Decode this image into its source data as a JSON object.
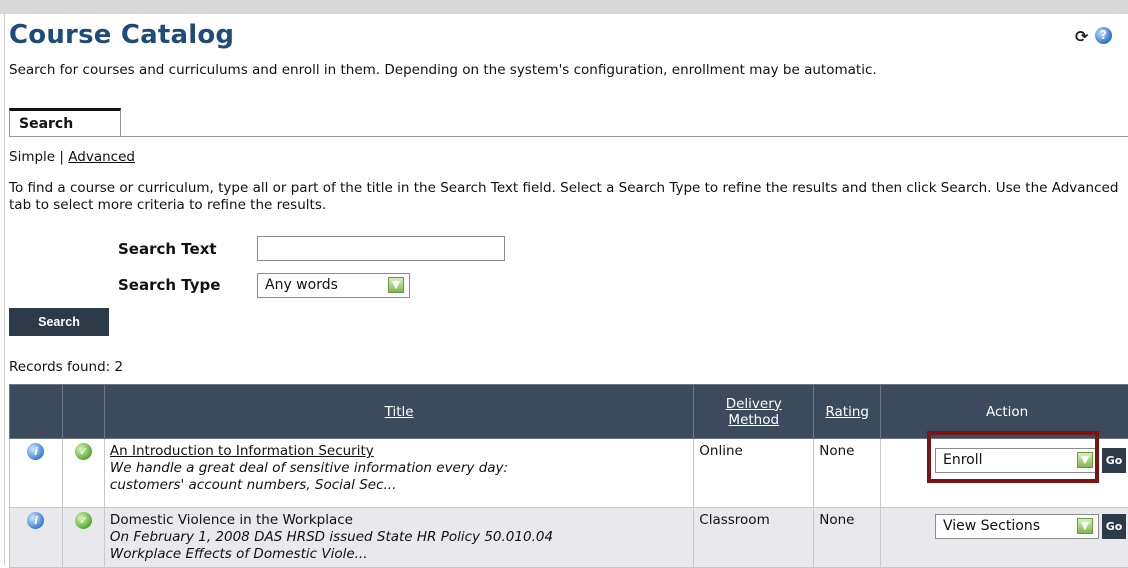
{
  "page": {
    "title": "Course Catalog",
    "description": "Search for courses and curriculums and enroll in them. Depending on the system's configuration, enrollment may be automatic.",
    "refresh_icon": "refresh-icon",
    "help_icon": "help-icon"
  },
  "tabs": [
    {
      "label": "Search",
      "active": true
    }
  ],
  "modes": {
    "simple": "Simple",
    "separator": "|",
    "advanced": "Advanced"
  },
  "instructions": "To find a course or curriculum, type all or part of the title in the Search Text field. Select a Search Type to refine the results and then click Search. Use the Advanced tab to select more criteria to refine the results.",
  "form": {
    "search_text_label": "Search Text",
    "search_text_value": "",
    "search_type_label": "Search Type",
    "search_type_value": "Any words",
    "search_button": "Search"
  },
  "records_found": "Records found: 2",
  "table": {
    "headers": {
      "title": "Title",
      "delivery_line1": "Delivery",
      "delivery_line2": "Method",
      "rating": "Rating",
      "action": "Action"
    },
    "rows": [
      {
        "title": "An Introduction to Information Security",
        "desc_line1": "We handle a great deal of sensitive information every day:",
        "desc_line2": "customers' account numbers, Social Sec...",
        "delivery": "Online",
        "rating": "None",
        "action": "Enroll",
        "go": "Go"
      },
      {
        "title": "Domestic Violence in the Workplace",
        "desc_line1": "On February 1, 2008 DAS HRSD issued State HR Policy 50.010.04",
        "desc_line2": "Workplace Effects of Domestic Viole...",
        "delivery": "Classroom",
        "rating": "None",
        "action": "View Sections",
        "go": "Go"
      }
    ]
  },
  "colors": {
    "title": "#1f4b7a",
    "header_bg": "#3b4a5c",
    "button_bg": "#2d3a4a",
    "highlight": "#7b1414"
  }
}
